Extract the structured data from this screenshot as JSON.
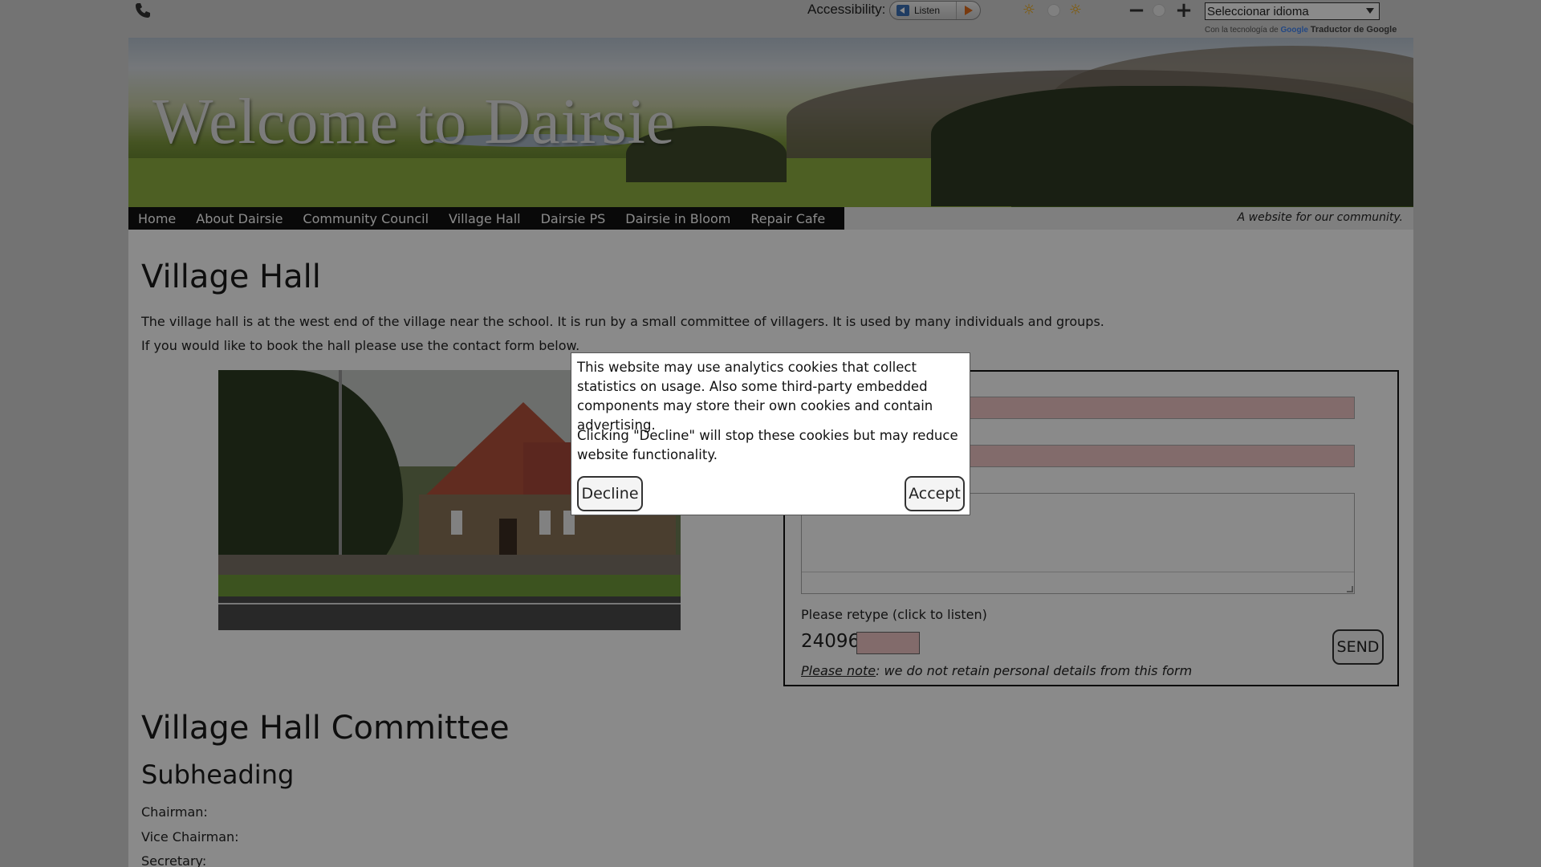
{
  "topbar": {
    "accessibility_label": "Accessibility:",
    "listen_label": "Listen",
    "language_select": {
      "selected": "Seleccionar idioma"
    },
    "powered_by_prefix": "Con la tecnología de",
    "powered_by_google": "Google",
    "powered_by_service": "Traductor de Google"
  },
  "banner": {
    "title": "Welcome to Dairsie"
  },
  "nav": {
    "items": [
      {
        "label": "Home"
      },
      {
        "label": "About Dairsie"
      },
      {
        "label": "Community Council"
      },
      {
        "label": "Village Hall"
      },
      {
        "label": "Dairsie PS"
      },
      {
        "label": "Dairsie in Bloom"
      },
      {
        "label": "Repair Cafe"
      }
    ],
    "tagline": "A website for our community."
  },
  "main": {
    "title": "Village Hall",
    "intro_1": "The village hall is at the west end of the village near the school. It is run by a small committee of villagers. It is used by many individuals and groups.",
    "intro_2": "If you would like to book the hall please use the contact form below."
  },
  "form": {
    "retype_label": "Please retype (click to listen)",
    "captcha_number": "24096",
    "send_label": "SEND",
    "note_link": "Please note",
    "note_text": ": we do not retain personal details from this form"
  },
  "committee": {
    "title": "Village Hall Committee",
    "subheading": "Subheading",
    "chairman": "Chairman:",
    "vice_chairman": "Vice Chairman:",
    "secretary": "Secretary:"
  },
  "cookie_dialog": {
    "text_1": "This website may use analytics cookies that collect statistics on usage. Also some third-party embedded components may store their own cookies and contain advertising.",
    "text_2": "Clicking \"Decline\" will stop these cookies but may reduce website functionality.",
    "decline_label": "Decline",
    "accept_label": "Accept"
  },
  "colors": {
    "overlay": "#000000",
    "nav_background": "#111111",
    "required_field": "#f0c6c6",
    "listen_play": "#e06b1a"
  }
}
